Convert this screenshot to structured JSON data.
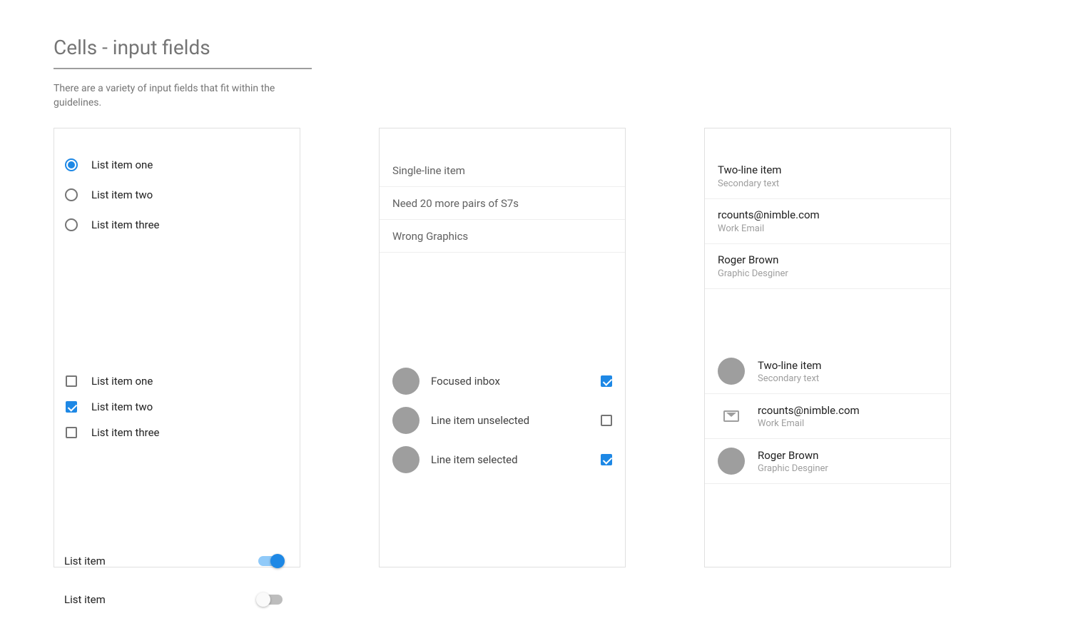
{
  "header": {
    "title": "Cells - input fields",
    "subtitle": "There are a variety of input fields that fit within the guidelines."
  },
  "card1": {
    "radios": [
      {
        "label": "List item one",
        "selected": true
      },
      {
        "label": "List item two",
        "selected": false
      },
      {
        "label": "List item three",
        "selected": false
      }
    ],
    "checks": [
      {
        "label": "List item one",
        "checked": false
      },
      {
        "label": "List item two",
        "checked": true
      },
      {
        "label": "List item three",
        "checked": false
      }
    ],
    "switches": [
      {
        "label": "List item",
        "on": true
      },
      {
        "label": "List item",
        "on": false
      }
    ]
  },
  "card2": {
    "singles": [
      "Single-line item",
      "Need 20 more pairs of S7s",
      "Wrong Graphics"
    ],
    "avatars": [
      {
        "label": "Focused inbox",
        "checked": true
      },
      {
        "label": "Line item unselected",
        "checked": false
      },
      {
        "label": "Line item selected",
        "checked": true
      }
    ]
  },
  "card3": {
    "twolines": [
      {
        "primary": "Two-line item",
        "secondary": "Secondary text"
      },
      {
        "primary": "rcounts@nimble.com",
        "secondary": "Work Email"
      },
      {
        "primary": "Roger Brown",
        "secondary": "Graphic Desginer"
      }
    ],
    "twolines_avatar": [
      {
        "primary": "Two-line item",
        "secondary": "Secondary text",
        "icon": "circle"
      },
      {
        "primary": "rcounts@nimble.com",
        "secondary": "Work Email",
        "icon": "mail"
      },
      {
        "primary": "Roger Brown",
        "secondary": "Graphic Desginer",
        "icon": "circle"
      }
    ]
  }
}
